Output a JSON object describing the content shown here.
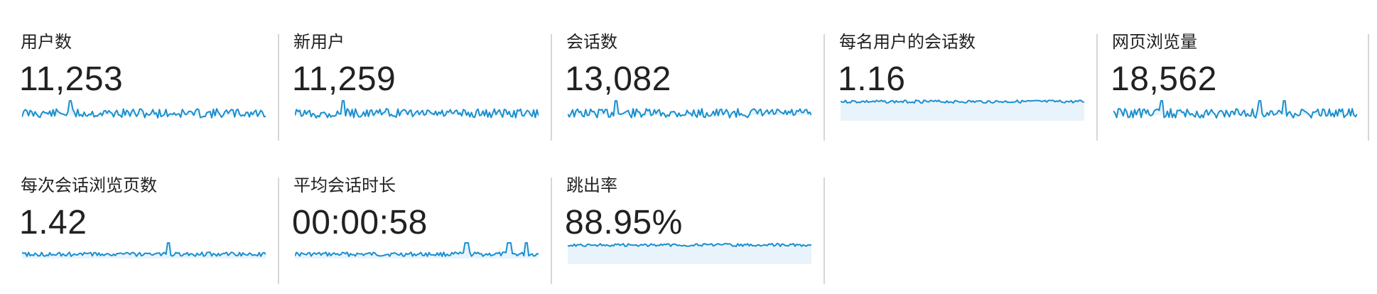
{
  "theme": {
    "line_color": "#1a8fcf",
    "fill_color": "#e8f3fb",
    "divider_color": "#d6d6d6",
    "text_color": "#212121"
  },
  "metrics": [
    {
      "label": "用户数",
      "value": "11,253",
      "style": "volatile",
      "seed": 11,
      "spikes": [
        0.2
      ]
    },
    {
      "label": "新用户",
      "value": "11,259",
      "style": "volatile",
      "seed": 12,
      "spikes": [
        0.2
      ]
    },
    {
      "label": "会话数",
      "value": "13,082",
      "style": "volatile",
      "seed": 13,
      "spikes": [
        0.2
      ]
    },
    {
      "label": "每名用户的会话数",
      "value": "1.16",
      "style": "flat-high",
      "seed": 14,
      "spikes": []
    },
    {
      "label": "网页浏览量",
      "value": "18,562",
      "style": "volatile",
      "seed": 15,
      "spikes": [
        0.2,
        0.6,
        0.7
      ]
    },
    {
      "label": "每次会话浏览页数",
      "value": "1.42",
      "style": "flat-low",
      "seed": 16,
      "spikes": [
        0.6
      ]
    },
    {
      "label": "平均会话时长",
      "value": "00:00:58",
      "style": "flat-low",
      "seed": 17,
      "spikes": [
        0.7,
        0.71,
        0.88,
        0.95
      ]
    },
    {
      "label": "跳出率",
      "value": "88.95%",
      "style": "flat-high",
      "seed": 18,
      "spikes": []
    }
  ]
}
